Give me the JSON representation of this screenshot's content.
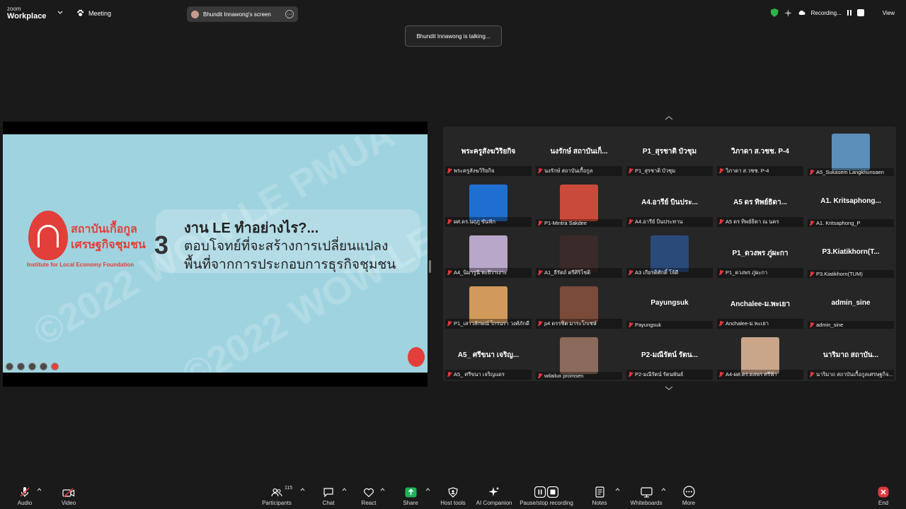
{
  "app": {
    "brand_small": "zoom",
    "brand_name": "Workplace"
  },
  "header": {
    "meeting_label": "Meeting",
    "screen_pill": "Bhundit Innawong's screen",
    "recording_label": "Recording...",
    "view_label": "View"
  },
  "talking_indicator": "Bhundit Innawong is talking...",
  "slide": {
    "watermark": "©2022 WOW LE PMUA",
    "org_name_line1": "สถาบันเกื้อกูล",
    "org_name_line2": "เศรษฐกิจชุมชน",
    "org_name_en": "Institute for Local Economy Foundation",
    "number": "3",
    "title": "งาน LE ทำอย่างไร?...",
    "line1": "ตอบโจทย์ที่จะสร้างการเปลี่ยนแปลง",
    "line2": "พื้นที่จากการประกอบการธุรกิจชุมชน"
  },
  "participants_gallery": [
    {
      "name": "พระครูสังฆวิริยกิจ",
      "label": "พระครูสังฆวิริยกิจ",
      "photo": null
    },
    {
      "name": "นงรักษ์ สถาบันเก็...",
      "label": "นงรักษ์ สถาบันเกื้อกูล",
      "photo": null
    },
    {
      "name": "P1_สุรชาติ บัวชุม",
      "label": "P1_สุรชาติ บัวชุม",
      "photo": null
    },
    {
      "name": "วิภาดา ส.วชช. P-4",
      "label": "วิภาดา ส.วชช. P-4",
      "photo": null
    },
    {
      "name": "",
      "label": "A5_Sukasem Langkhunsaen",
      "photo": "#5b8fb9"
    },
    {
      "name": "",
      "label": "ผศ.ดร.นฤภู ขันฟัก",
      "photo": "#1f6fd0"
    },
    {
      "name": "",
      "label": "P1-Mintra Sakdee",
      "photo": "#c94a3a"
    },
    {
      "name": "A4.อารีย์ บินประ...",
      "label": "A4.อารีย์ บินประทาน",
      "photo": null
    },
    {
      "name": "A5 ดร ทิพย์ธิดา...",
      "label": "A5 ดร ทิพย์ธิดา ณ นคร",
      "photo": null
    },
    {
      "name": "A1.  Kritsaphong...",
      "label": "A1. Kritsaphong_P",
      "photo": null
    },
    {
      "name": "",
      "label": "A4_นิมารูนี หะยีวาเงาะ",
      "photo": "#b9a7c9"
    },
    {
      "name": "",
      "label": "A1_ธีรัตถ์ ตรีศิริโชติ",
      "photo": "#3a2a2a"
    },
    {
      "name": "",
      "label": "A3 เกียรติศักดิ์ โจ้ดี",
      "photo": "#2a4a7a"
    },
    {
      "name": "P1_ดวงพร ภู่ผะกา",
      "label": "P1_ดวงพร ภู่ผะกา",
      "photo": null
    },
    {
      "name": "P3.Kiatikhorn(T...",
      "label": "P3.Kiatikhorn(TUM)",
      "photo": null
    },
    {
      "name": "",
      "label": "P1_เสาวลักษณ์ ไกรนรา วงศ์ภักดี",
      "photo": "#d19a5a"
    },
    {
      "name": "",
      "label": "p4 ดรรชิต มาระโกเชษ์",
      "photo": "#7a4a3a"
    },
    {
      "name": "Payungsuk",
      "label": "Payungsuk",
      "photo": null
    },
    {
      "name": "Anchalee-ม.พะเยา",
      "label": "Anchalee-ม.พะเยา",
      "photo": null
    },
    {
      "name": "admin_sine",
      "label": "admin_sine",
      "photo": null
    },
    {
      "name": "A5_ ศรีขนา เจริญ...",
      "label": "A5_ ศรีขนา เจริญแดร",
      "photo": null
    },
    {
      "name": "",
      "label": "wilailux promsen",
      "photo": "#8a6a5a"
    },
    {
      "name": "P2-มณีรัตน์ รัตน...",
      "label": "P2-มณีรัตน์ รัตนพันธ์",
      "photo": null
    },
    {
      "name": "",
      "label": "A4-ผศ.ดร.ดลพร ศรีฟ้า",
      "photo": "#c9a58a"
    },
    {
      "name": "นาริมาถ สถาบัน...",
      "label": "นาริมาถ สถาบันเกื้อกูลเศรษฐกิจ...",
      "photo": null
    }
  ],
  "toolbar": {
    "audio": "Audio",
    "video": "Video",
    "participants": "Participants",
    "participants_count": "115",
    "chat": "Chat",
    "react": "React",
    "share": "Share",
    "host_tools": "Host tools",
    "ai_companion": "AI Companion",
    "pause_recording": "Pause/stop recording",
    "notes": "Notes",
    "whiteboards": "Whiteboards",
    "more": "More",
    "end": "End"
  },
  "colors": {
    "share_green": "#1fb25a",
    "muted_red": "#e0393e",
    "end_red": "#e0393e",
    "secure_green": "#2db34a",
    "slide_bg": "#9fd3e0",
    "brand_red": "#e23f3a"
  }
}
